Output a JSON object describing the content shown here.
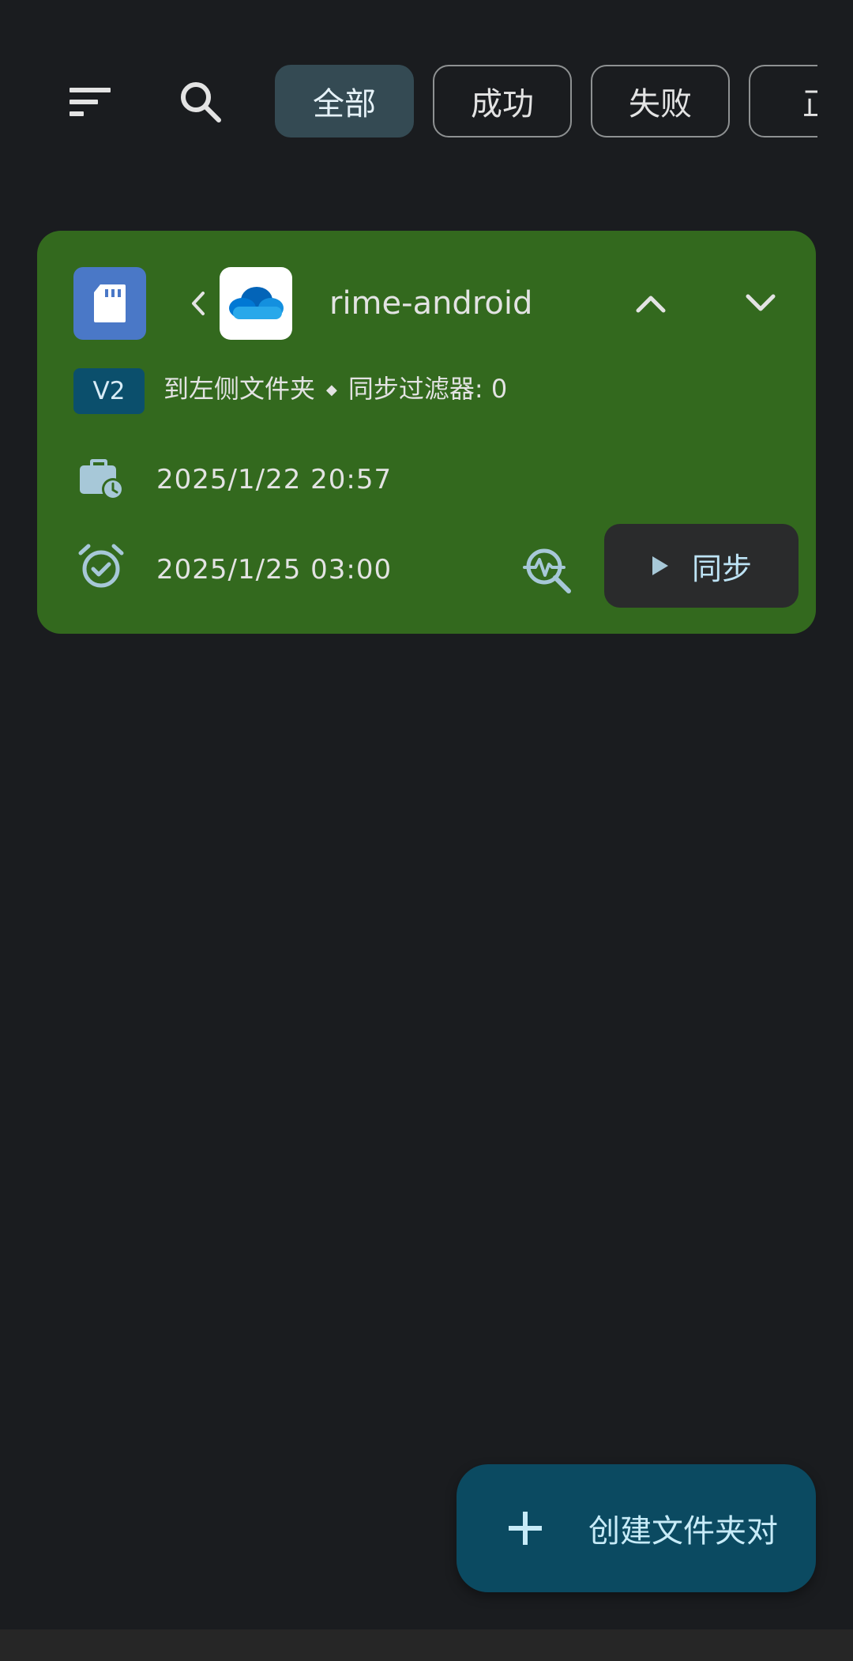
{
  "toolbar": {
    "sort_icon": "sort-icon",
    "search_icon": "search-icon",
    "filters": [
      {
        "label": "全部",
        "selected": true
      },
      {
        "label": "成功",
        "selected": false
      },
      {
        "label": "失败",
        "selected": false
      },
      {
        "label": "正",
        "selected": false
      }
    ]
  },
  "card": {
    "background": "#33691e",
    "left_icon": "sd-card-icon",
    "direction_icon": "chevron-left-icon",
    "right_icon": "onedrive-cloud-icon",
    "title": "rime-android",
    "version_badge": "V2",
    "direction_text": "到左侧文件夹",
    "filter_text": "同步过滤器: 0",
    "last_sync_time": "2025/1/22 20:57",
    "next_sync_time": "2025/1/25 03:00",
    "sync_button_label": "同步"
  },
  "fab": {
    "label": "创建文件夹对"
  }
}
